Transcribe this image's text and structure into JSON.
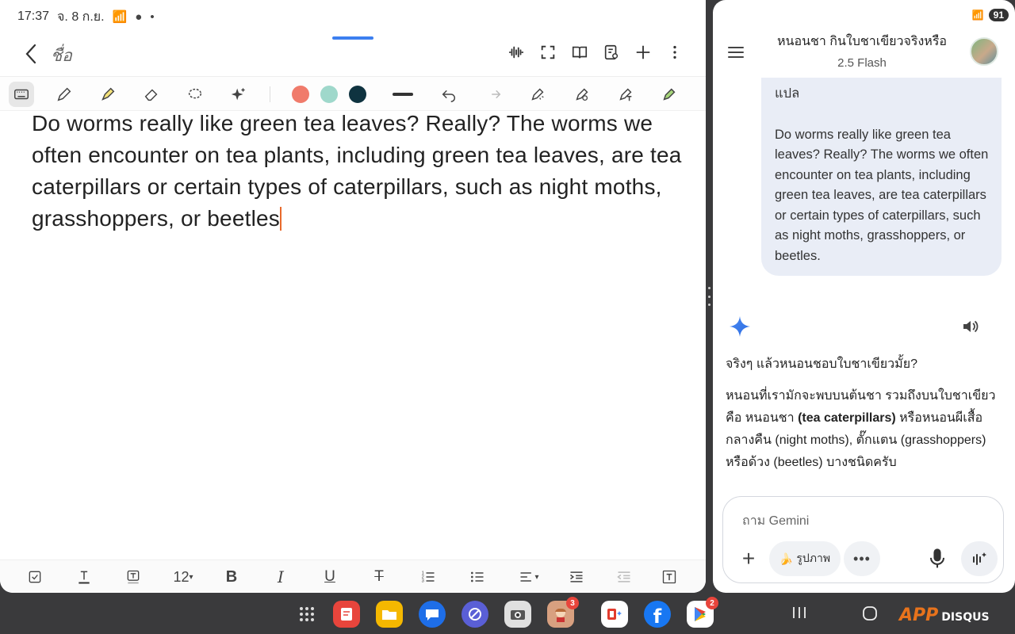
{
  "status_bar": {
    "time": "17:37",
    "date": "จ. 8 ก.ย.",
    "battery": "91"
  },
  "note": {
    "title": "ชื่อ",
    "body": "Do worms really like green tea leaves? Really? The worms we often encounter on tea plants, including green tea leaves, are tea caterpillars or certain types of caterpillars, such as night moths, grasshoppers, or beetles"
  },
  "toolbar": {
    "colors": [
      "#f07b6b",
      "#9fd8cb",
      "#0f3340"
    ],
    "icons": [
      "keyboard-icon",
      "pen-icon",
      "highlighter-icon",
      "eraser-icon",
      "lasso-icon",
      "sparkle-icon",
      "undo-icon",
      "redo-icon"
    ]
  },
  "format_bar": {
    "font_size": "12"
  },
  "gemini": {
    "chat_title": "หนอนชา กินใบชาเขียวจริงหรือ",
    "model": "2.5 Flash",
    "user_message": {
      "line1": "แปล",
      "line2": "Do worms really like green tea leaves? Really? The worms we often encounter on tea plants, including green tea leaves, are tea caterpillars or certain types of caterpillars, such as night moths, grasshoppers, or beetles."
    },
    "answer_question": "จริงๆ แล้วหนอนชอบใบชาเขียวมั้ย?",
    "answer_pre": "หนอนที่เรามักจะพบบนต้นชา รวมถึงบนใบชาเขียว คือ หนอนชา ",
    "answer_bold": "(tea caterpillars)",
    "answer_post": " หรือหนอนผีเสื้อกลางคืน (night moths), ตั๊กแตน (grasshoppers) หรือด้วง (beetles) บางชนิดครับ",
    "input_placeholder": "ถาม Gemini",
    "image_chip_label": "รูปภาพ",
    "more_label": "•••"
  },
  "dock": {
    "apps": [
      {
        "name": "apps-grid",
        "color": "transparent"
      },
      {
        "name": "samsung-notes",
        "color": "#e8453c"
      },
      {
        "name": "my-files",
        "color": "#f5b800"
      },
      {
        "name": "messages",
        "color": "#1e6ee8"
      },
      {
        "name": "internet",
        "color": "#5a5fd6"
      },
      {
        "name": "camera",
        "color": "#e0e0e0"
      },
      {
        "name": "game",
        "color": "#d8a080",
        "badge": "3"
      },
      {
        "name": "office",
        "color": "#ffffff"
      },
      {
        "name": "facebook",
        "color": "#1877f2"
      },
      {
        "name": "play-store",
        "color": "#ffffff",
        "badge": "2"
      }
    ]
  },
  "watermark": {
    "app": "APP",
    "disqus": "DISQUS"
  }
}
